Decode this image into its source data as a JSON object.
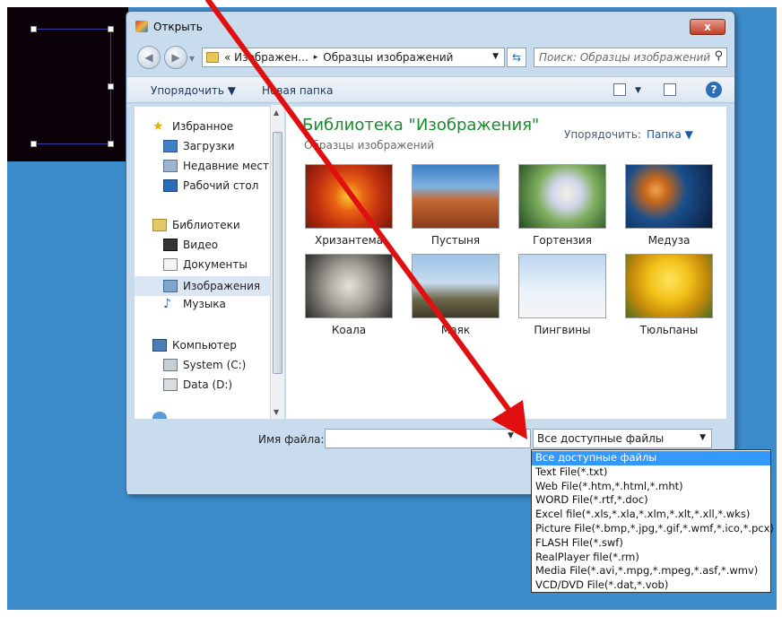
{
  "dialog": {
    "title": "Открыть",
    "close_label": "x"
  },
  "navbar": {
    "back_glyph": "◀",
    "forward_glyph": "▶",
    "address_prefix": "«",
    "address_parts": [
      "Изображен...",
      "Образцы изображений"
    ],
    "address_sep": "▸",
    "search_placeholder": "Поиск: Образцы изображений"
  },
  "toolbar": {
    "organize_label": "Упорядочить ▼",
    "new_folder_label": "Новая папка"
  },
  "sidebar": {
    "items": [
      {
        "label": "Избранное",
        "icon": "star-icon"
      },
      {
        "label": "Загрузки",
        "icon": "downloads-icon"
      },
      {
        "label": "Недавние места",
        "icon": "recent-places-icon"
      },
      {
        "label": "Рабочий стол",
        "icon": "desktop-icon"
      },
      {
        "label": "Библиотеки",
        "icon": "libraries-icon"
      },
      {
        "label": "Видео",
        "icon": "video-icon"
      },
      {
        "label": "Документы",
        "icon": "documents-icon"
      },
      {
        "label": "Изображения",
        "icon": "pictures-icon"
      },
      {
        "label": "Музыка",
        "icon": "music-icon"
      },
      {
        "label": "Компьютер",
        "icon": "computer-icon"
      },
      {
        "label": "System (C:)",
        "icon": "drive-c-icon"
      },
      {
        "label": "Data (D:)",
        "icon": "drive-d-icon"
      }
    ]
  },
  "content": {
    "library_title": "Библиотека \"Изображения\"",
    "library_subtitle": "Образцы изображений",
    "arrange_label": "Упорядочить:",
    "arrange_value": "Папка ▼",
    "files": [
      {
        "label": "Хризантема"
      },
      {
        "label": "Пустыня"
      },
      {
        "label": "Гортензия"
      },
      {
        "label": "Медуза"
      },
      {
        "label": "Коала"
      },
      {
        "label": "Маяк"
      },
      {
        "label": "Пингвины"
      },
      {
        "label": "Тюльпаны"
      }
    ]
  },
  "bottom": {
    "filename_label": "Имя файла:",
    "filename_value": "",
    "filetype_value": "Все доступные файлы"
  },
  "filetype_options": [
    "Все доступные файлы",
    "Text File(*.txt)",
    "Web File(*.htm,*.html,*.mht)",
    "WORD File(*.rtf,*.doc)",
    "Excel file(*.xls,*.xla,*.xlm,*.xlt,*.xll,*.wks)",
    "Picture File(*.bmp,*.jpg,*.gif,*.wmf,*.ico,*.pcx)",
    "FLASH File(*.swf)",
    "RealPlayer file(*.rm)",
    "Media File(*.avi,*.mpg,*.mpeg,*.asf,*.wmv)",
    "VCD/DVD File(*.dat,*.vob)"
  ],
  "colors": {
    "desktop": "#3c8ccb",
    "library_title": "#1a8a2e",
    "selected_option": "#3399ff",
    "annotation_arrow": "#e01010"
  }
}
